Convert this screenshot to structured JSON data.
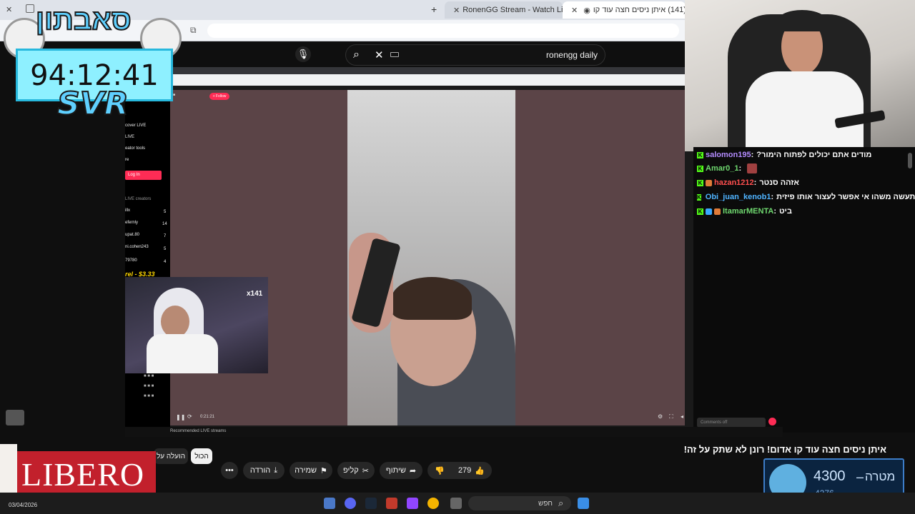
{
  "browser": {
    "tabs": [
      {
        "title": "RonenGG Stream - Watch Live"
      },
      {
        "title": "(141) איתן ניסים חצה עוד קו"
      }
    ]
  },
  "youtube": {
    "search_value": "ronengg daily"
  },
  "overlay": {
    "brand": "סאבתון",
    "timer": "94:12:41",
    "tag": "SVR"
  },
  "embedded": {
    "follow_label": "+ Follow",
    "sidebar_items": [
      "cover LIVE",
      "LIVE",
      "eator tools",
      "re"
    ],
    "login_label": "Log In",
    "creators_heading": "LIVE creators",
    "creators": [
      "illx",
      "efernly",
      "upat.80",
      "ni.cohen243",
      "79780"
    ],
    "creator_counts": [
      "5",
      "14",
      "7",
      "5",
      "4"
    ],
    "donation": "rel - $3.33",
    "cam_badge": "x141",
    "time_display": "0:21:21",
    "recommended": "Recommended LIVE streams",
    "comments_off": "Comments off"
  },
  "chat": {
    "messages": [
      {
        "user": "salomon195",
        "text": "מודים אתם יכולים לפתוח הימור?",
        "color": "#b48cff",
        "badges": [
          "k"
        ]
      },
      {
        "user": "Amar0_1",
        "text": "",
        "color": "#6fd86f",
        "badges": [
          "k"
        ]
      },
      {
        "user": "hazan1212",
        "text": "אזהה סנטר",
        "color": "#ff4f4f",
        "badges": [
          "k",
          "sword"
        ]
      },
      {
        "user": "Obi_juan_kenob1",
        "text": "לא תעשה משהו אי אפשר לעצור אותו פיזית",
        "color": "#4fb3ff",
        "badges": [
          "k",
          "sword"
        ]
      },
      {
        "user": "ItamarMENTA",
        "text": "ביט",
        "color": "#6fd86f",
        "badges": [
          "k",
          "gem",
          "sword"
        ]
      }
    ]
  },
  "video": {
    "title": "איתן ניסים חצה עוד קו אדום! רונן לא שתק על זה!",
    "likes": "279",
    "actions": {
      "share": "שיתוף",
      "clip": "קליפ",
      "save": "שמירה",
      "download": "הורדה"
    },
    "chips": [
      "הכול",
      "הועלה על"
    ]
  },
  "goal": {
    "label": "מטרה",
    "target": "4300",
    "current": "4276"
  },
  "ad": {
    "brand": "LIBERO"
  },
  "taskbar": {
    "search": "חפש",
    "date": "03/04/2026"
  }
}
